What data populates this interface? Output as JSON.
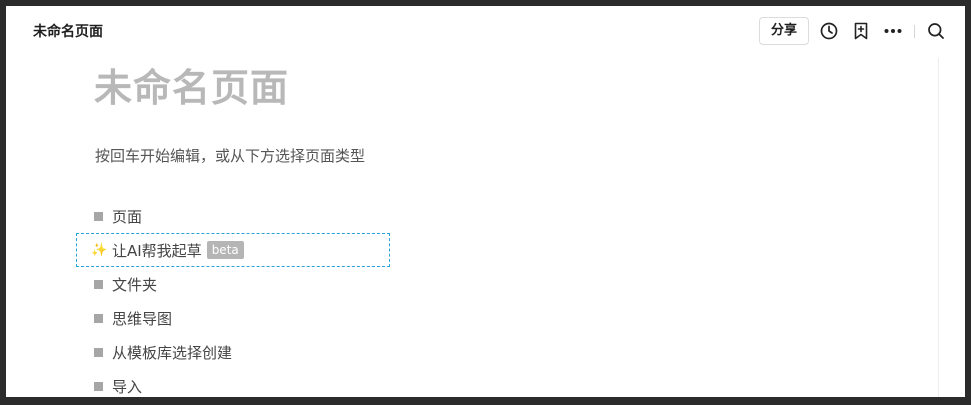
{
  "header": {
    "doc_title": "未命名页面",
    "share_label": "分享",
    "icons": [
      "history-icon",
      "bookmark-add-icon",
      "more-icon",
      "search-icon"
    ]
  },
  "page": {
    "title": "未命名页面",
    "hint": "按回车开始编辑，或从下方选择页面类型"
  },
  "options": [
    {
      "label": "页面",
      "icon": "square-bullet-icon"
    },
    {
      "label": "让AI帮我起草",
      "icon": "sparkle-icon",
      "badge": "beta",
      "selected": true
    },
    {
      "label": "文件夹",
      "icon": "square-bullet-icon"
    },
    {
      "label": "思维导图",
      "icon": "square-bullet-icon"
    },
    {
      "label": "从模板库选择创建",
      "icon": "square-bullet-icon"
    },
    {
      "label": "导入",
      "icon": "square-bullet-icon"
    }
  ],
  "colors": {
    "selection_border": "#29a3d8",
    "sparkle": "#f2b826",
    "badge_bg": "#b5b5b5",
    "title_gray": "#b8b8b8"
  }
}
